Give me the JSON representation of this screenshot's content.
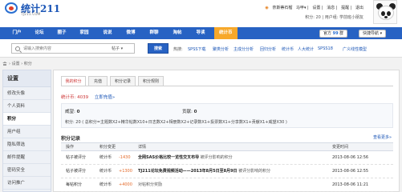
{
  "header": {
    "logo_text": "统计211",
    "logo_sub": "TJ211.COM",
    "links": [
      "奈斯蒂石榴",
      "马甲",
      "设置",
      "消息",
      "提醒",
      "退出"
    ],
    "user_meta": "积分: 20 | 用户组: 学前班小朋友",
    "avatar_alt": "熊猫头像"
  },
  "nav": {
    "items": [
      "门户",
      "论坛",
      "圈子",
      "家园",
      "说说",
      "微博",
      "群聊",
      "淘帖",
      "导读",
      "统计币"
    ],
    "active": "统计币",
    "my_site_label": "官方",
    "my_site_count": "99",
    "my_site_suffix": "群",
    "quick_nav": "快捷导航"
  },
  "search": {
    "placeholder": "请输入搜索内容",
    "scope": "帖子",
    "button": "搜索",
    "hot_label": "热搜:",
    "hot_links": [
      "SPSS下载",
      "聚类分析",
      "主成分分析",
      "回归分析",
      "统计币",
      "人大统计",
      "SPSS18",
      "广义线性模型"
    ]
  },
  "breadcrumb": {
    "items": [
      "设置",
      "积分"
    ],
    "separator": "›"
  },
  "sidebar": {
    "title": "设置",
    "items": [
      "修改头像",
      "个人资料",
      "积分",
      "用户组",
      "隐私筛选",
      "邮件提醒",
      "密码安全",
      "访问推广"
    ],
    "active": "积分"
  },
  "tabs": [
    "我的积分",
    "充值",
    "积分记录",
    "积分规则"
  ],
  "active_tab": "我的积分",
  "points": {
    "label": "统计币:",
    "value": "4039",
    "rule_link": "立即充值»"
  },
  "stats": {
    "reputation_label": "威望:",
    "reputation_value": "0",
    "contribution_label": "贡献:",
    "contribution_value": "0",
    "formula": "积分: 20 ( 总积分=主题数X2+精华帖数X10+日志数X2+相册数X2+记录数X1+投票数X1+分享数X1+贡献X1+威望X30 )"
  },
  "log": {
    "title": "积分记录",
    "more": "查看更多»",
    "columns": [
      "操作",
      "积分变更",
      "详情",
      "变更时间"
    ],
    "rows": [
      {
        "action": "帖子被评分",
        "currency": "统计币",
        "change": "-1430",
        "detail_bold": "全网SAS价格比较一览性交叉布导",
        "detail_rest": "被评分影响的积分",
        "time": "2013-08-06 12:56"
      },
      {
        "action": "帖子被评分",
        "currency": "统计币",
        "change": "+1300",
        "detail_bold": "TJ211论坛免费视频活动——2013年8月5日至8月9日",
        "detail_rest": "被评分影响的积分",
        "time": "2013-08-06 12:55"
      },
      {
        "action": "每帖积分",
        "currency": "统计币",
        "change": "+4000",
        "detail_bold": "",
        "detail_rest": "对帖积分奖励",
        "time": "2013-08-06 11:21"
      }
    ]
  },
  "colors": {
    "nav_blue": "#2762c3",
    "nav_active": "#f7a82a",
    "accent_red": "#cc3333",
    "change_orange": "#e46b2b"
  }
}
